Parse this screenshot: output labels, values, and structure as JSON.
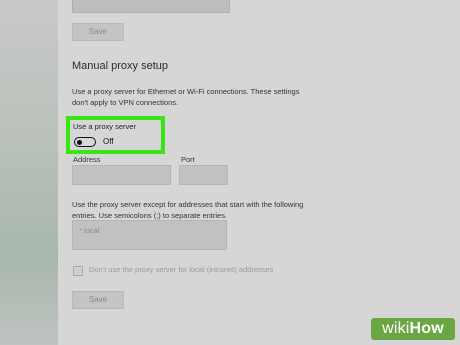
{
  "proxy": {
    "top_save_label": "Save",
    "heading": "Manual proxy setup",
    "description_line1": "Use a proxy server for Ethernet or Wi-Fi connections. These settings",
    "description_line2": "don't apply to VPN connections.",
    "toggle_label": "Use a proxy server",
    "toggle_state": "Off",
    "toggle_on": false,
    "address_label": "Address",
    "address_value": "",
    "port_label": "Port",
    "port_value": "",
    "exceptions_desc_line1": "Use the proxy server except for addresses that start with the following",
    "exceptions_desc_line2": "entries. Use semicolons (;) to separate entries.",
    "exceptions_placeholder": "*.local",
    "local_checkbox_label": "Don't use the proxy server for local (intranet) addresses",
    "local_checkbox_checked": false,
    "bottom_save_label": "Save"
  },
  "highlight_color": "#39e614",
  "watermark": {
    "part1": "wiki",
    "part2": "How",
    "color": "#6aa744"
  }
}
